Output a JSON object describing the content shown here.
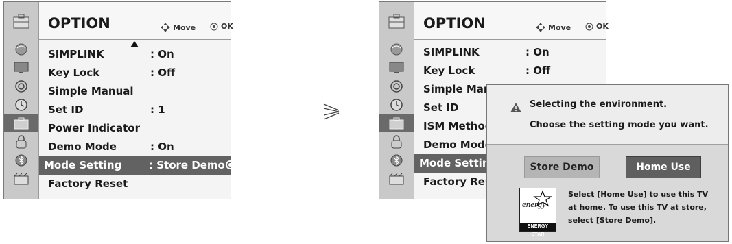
{
  "left_menu": {
    "title": "OPTION",
    "hint_move": "Move",
    "hint_ok": "OK",
    "rows": [
      {
        "label": "SIMPLINK",
        "value": ": On"
      },
      {
        "label": "Key Lock",
        "value": ": Off"
      },
      {
        "label": "Simple Manual",
        "value": ""
      },
      {
        "label": "Set ID",
        "value": ": 1"
      },
      {
        "label": "Power Indicator",
        "value": ""
      },
      {
        "label": "Demo Mode",
        "value": ": On"
      },
      {
        "label": "Mode Setting",
        "value": ": Store Demo"
      },
      {
        "label": "Factory Reset",
        "value": ""
      }
    ],
    "selected_index": 6
  },
  "right_menu": {
    "title": "OPTION",
    "hint_move": "Move",
    "hint_ok": "OK",
    "rows": [
      {
        "label": "SIMPLINK",
        "value": ": On"
      },
      {
        "label": "Key Lock",
        "value": ": Off"
      },
      {
        "label": "Simple Man",
        "value": ""
      },
      {
        "label": "Set ID",
        "value": ""
      },
      {
        "label": "ISM Method",
        "value": ""
      },
      {
        "label": "Demo Mode",
        "value": ""
      },
      {
        "label": "Mode Setting",
        "value": ""
      },
      {
        "label": "Factory Rese",
        "value": ""
      }
    ],
    "selected_index": 6
  },
  "dialog": {
    "line1": "Selecting the environment.",
    "line2": "Choose the setting mode you want.",
    "store_button": "Store Demo",
    "home_button": "Home Use",
    "note": "Select [Home Use] to use this TV at home. To use this TV at store, select [Store Demo].",
    "logo_script": "energy",
    "logo_text": "ENERGY STAR"
  },
  "sidebar_icons": [
    "antenna-icon",
    "picture-icon",
    "audio-icon",
    "clock-icon",
    "lock-icon",
    "option-icon",
    "bluetooth-icon",
    "media-icon"
  ],
  "colors": {
    "selected_row": "#626262",
    "sidebar": "#c9c9c9",
    "home_button": "#5f5f5f",
    "store_button": "#b5b5b5"
  }
}
